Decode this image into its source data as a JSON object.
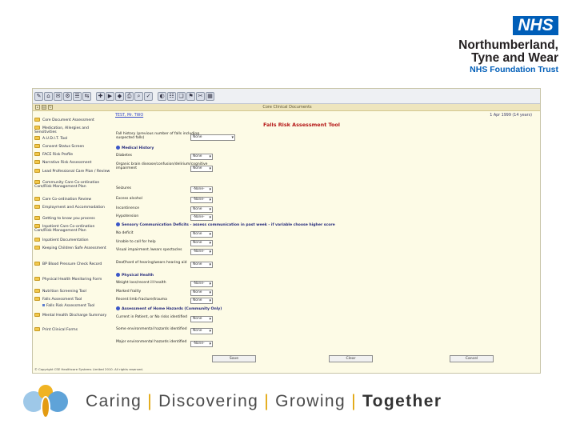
{
  "branding": {
    "nhs_logo": "NHS",
    "org_line1": "Northumberland,",
    "org_line2": "Tyne and Wear",
    "trust": "NHS Foundation Trust",
    "tagline_words": [
      "Caring",
      "Discovering",
      "Growing",
      "Together"
    ],
    "separator": "|",
    "colors": {
      "nhs_blue": "#005eb8",
      "separator": "#e0a100"
    }
  },
  "app": {
    "window_title": "Core Clinical Documents",
    "patient_link": "TEST, Mr. TWO",
    "patient_dob": "1 Apr 1999 (14 years)",
    "form_title": "Falls Risk Assessment Tool",
    "toolbar_icons": [
      "tool-icon-1",
      "tool-icon-2",
      "tool-icon-3",
      "tool-icon-4",
      "tool-icon-5",
      "tool-icon-6",
      "tool-icon-7",
      "tool-icon-8",
      "tool-icon-9",
      "tool-icon-10",
      "tool-icon-11",
      "tool-icon-12",
      "tool-icon-13",
      "tool-icon-14",
      "tool-icon-15",
      "tool-icon-16",
      "tool-icon-17",
      "tool-icon-18"
    ],
    "nav": [
      "Core Document Assessment",
      "Medication, Allergies and Sensitivities",
      "A.U.D.I.T. Tool",
      "Consent Status Screen",
      "FACE Risk Profile",
      "Narrative Risk Assessment",
      "Lead Professional Care Plan / Review",
      "Community Care Co-ordination Care/Risk Management Plan",
      "Care Co-ordination Review",
      "Employment and Accommodation",
      "Getting to know you process",
      "Inpatient Care Co-ordination Care/Risk Management Plan",
      "Inpatient Documentation",
      "Keeping Children Safe Assessment",
      "BP Blood Pressure Check Record",
      "Physical Health Monitoring Form",
      "Nutrition Screening Tool",
      "Falls Assessment Tool",
      "Falls Risk Assessment Tool",
      "Mental Health Discharge Summary",
      "Print Clinical Forms"
    ],
    "rows": [
      {
        "label": "Fall history (previous number of falls including suspected falls)",
        "value": "None"
      },
      {
        "section": "Medical History"
      },
      {
        "label": "Diabetes",
        "value": "None"
      },
      {
        "label": "Organic brain disease/confusion/delirium/cognitive impairment",
        "value": "None"
      },
      {
        "label": "Seizures",
        "value": "-None-"
      },
      {
        "label": "Excess alcohol",
        "value": "-None-"
      },
      {
        "label": "Incontinence",
        "value": "None"
      },
      {
        "label": "Hypotension",
        "value": "-None-"
      },
      {
        "section": "Sensory Communication Deficits - assess communication in past week - if variable choose higher score"
      },
      {
        "label": "No deficit",
        "value": "None"
      },
      {
        "label": "Unable to call for help",
        "value": "None"
      },
      {
        "label": "Visual impairment /wears spectacles",
        "value": "-None-"
      },
      {
        "label": "Deaf/hard of hearing/wears hearing aid",
        "value": "None"
      },
      {
        "section": "Physical Health"
      },
      {
        "label": "Weight loss/recent ill health",
        "value": "-None-"
      },
      {
        "label": "Marked frailty",
        "value": "None"
      },
      {
        "label": "Recent limb fracture/trauma",
        "value": "None"
      },
      {
        "section": "Assessment of Home Hazards (Community Only)"
      },
      {
        "label": "Current in Patient, or No risks identified",
        "value": "None"
      },
      {
        "label": "Some environmental hazards identified",
        "value": "None"
      },
      {
        "label": "Major environmental hazards identified",
        "value": "-None-"
      }
    ],
    "buttons": {
      "save": "Save",
      "clear": "Clear",
      "cancel": "Cancel"
    },
    "copyright": "© Copyright CSE Healthcare Systems Limited 2010. All rights reserved."
  }
}
